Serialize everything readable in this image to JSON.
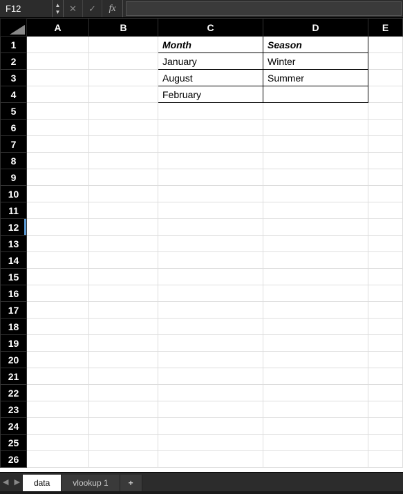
{
  "nameBox": "F12",
  "formula": "",
  "fxLabel": "fx",
  "activeRow": 12,
  "columns": [
    "A",
    "B",
    "C",
    "D",
    "E"
  ],
  "rowCount": 26,
  "cells": {
    "C1": {
      "v": "Month",
      "header": true,
      "border": true
    },
    "D1": {
      "v": "Season",
      "header": true,
      "border": true
    },
    "C2": {
      "v": "January",
      "border": true
    },
    "D2": {
      "v": "Winter",
      "border": true
    },
    "C3": {
      "v": "August",
      "border": true
    },
    "D3": {
      "v": "Summer",
      "border": true
    },
    "C4": {
      "v": "February",
      "border": true
    },
    "D4": {
      "v": "",
      "border": true
    }
  },
  "tabs": [
    {
      "label": "data",
      "active": true
    },
    {
      "label": "vlookup 1",
      "active": false
    }
  ],
  "addTabLabel": "+"
}
